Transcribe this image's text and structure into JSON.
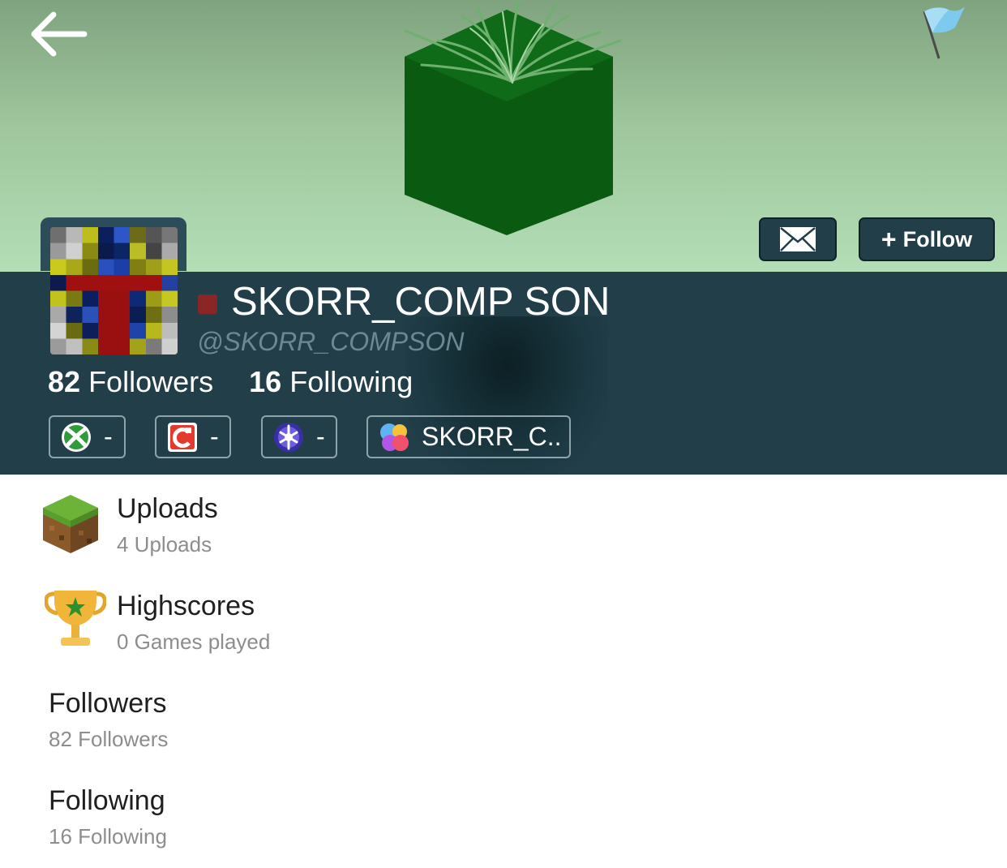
{
  "header": {
    "back_icon": "arrow-left-icon",
    "report_icon": "flag-icon",
    "cover_image": "grass-block-cover"
  },
  "profile": {
    "display_name": "SKORR_COMP SON",
    "handle": "@SKORR_COMPSON",
    "status_color": "#8a2626",
    "followers_count": "82",
    "followers_label": "Followers",
    "following_count": "16",
    "following_label": "Following",
    "message_icon": "envelope-icon",
    "follow_label": "Follow",
    "follow_plus": "+"
  },
  "gamer_tags": [
    {
      "icon": "xbox-icon",
      "value": "-"
    },
    {
      "icon": "nintendo-icon",
      "value": "-"
    },
    {
      "icon": "playstation-icon",
      "value": "-"
    },
    {
      "icon": "game-center-icon",
      "value": "SKORR_C.."
    }
  ],
  "sections": [
    {
      "title": "Uploads",
      "subtitle": "4 Uploads",
      "icon": "grass-block-icon"
    },
    {
      "title": "Highscores",
      "subtitle": "0 Games played",
      "icon": "trophy-icon"
    },
    {
      "title": "Followers",
      "subtitle": "82 Followers"
    },
    {
      "title": "Following",
      "subtitle": "16 Following"
    }
  ],
  "colors": {
    "panel": "#223e49",
    "header_top": "#7fa37f",
    "header_bottom": "#b3deb6"
  }
}
